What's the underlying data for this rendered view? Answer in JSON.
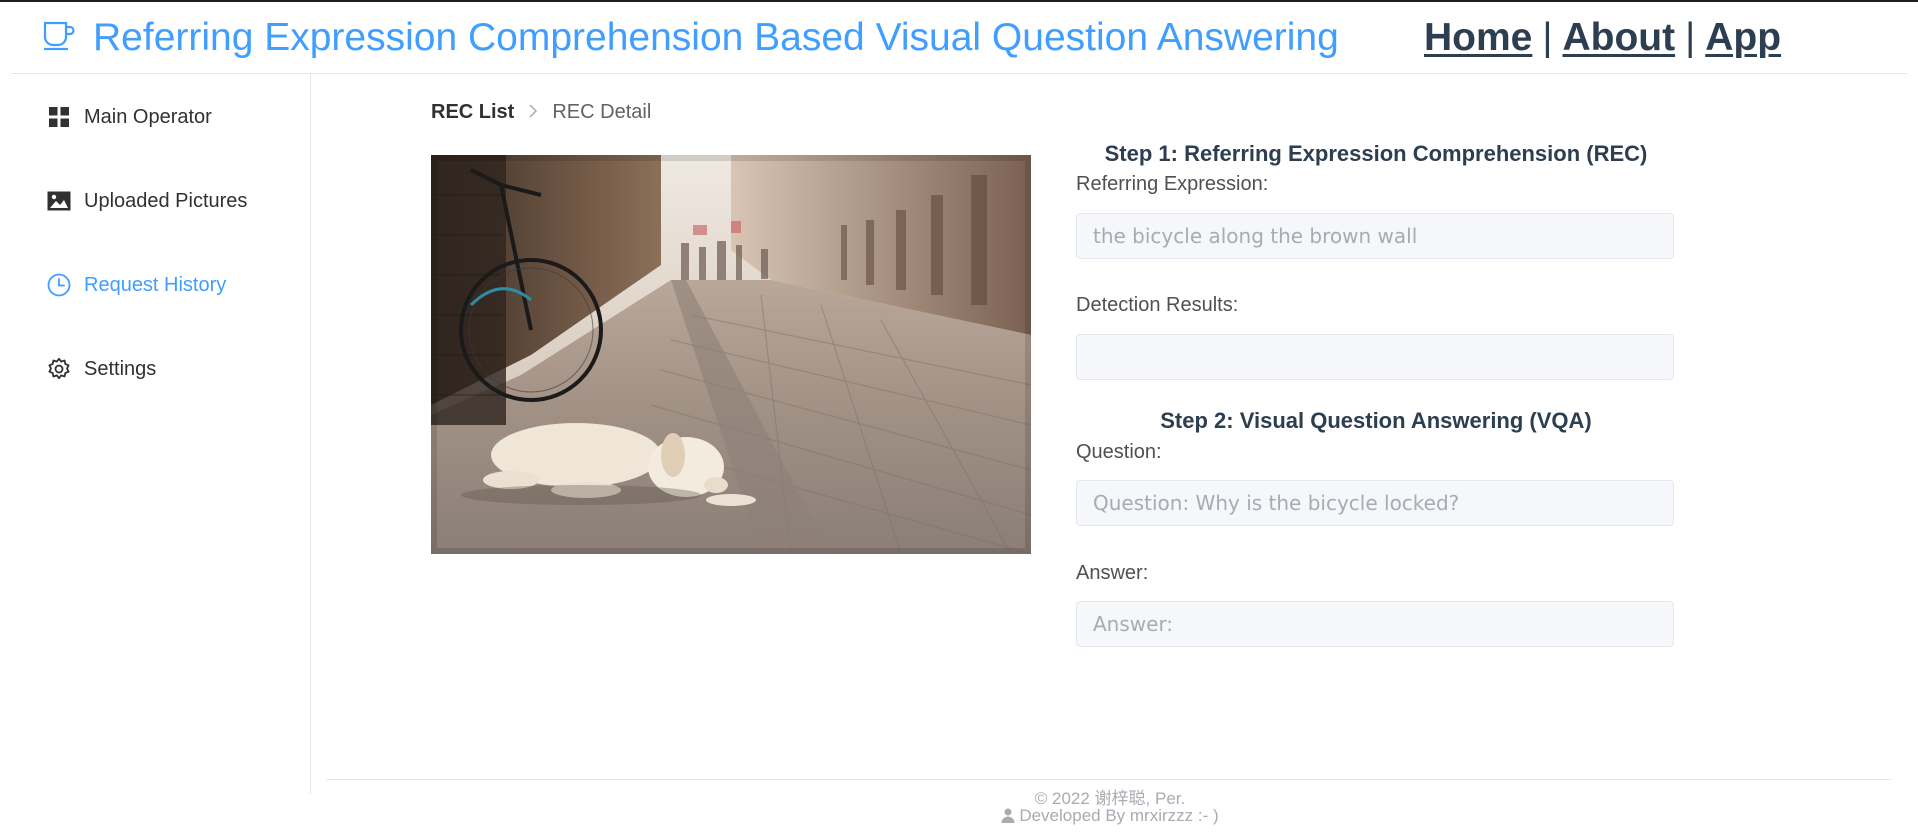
{
  "header": {
    "logo_icon": "coffee-cup-icon",
    "title": "Referring Expression Comprehension Based Visual Question Answering",
    "nav": [
      {
        "label": "Home"
      },
      {
        "label": "About"
      },
      {
        "label": "App"
      }
    ],
    "nav_separator": "|",
    "title_color": "#409eff"
  },
  "sidebar": {
    "items": [
      {
        "label": "Main Operator",
        "icon": "grid-icon",
        "active": false
      },
      {
        "label": "Uploaded Pictures",
        "icon": "picture-icon",
        "active": false
      },
      {
        "label": "Request History",
        "icon": "clock-icon",
        "active": true
      },
      {
        "label": "Settings",
        "icon": "gear-icon",
        "active": false
      }
    ],
    "active_color": "#409eff"
  },
  "breadcrumb": {
    "items": [
      "REC List",
      "REC Detail"
    ]
  },
  "photo": {
    "subject": "a white puppy lying on a cobblestone street beside a bicycle"
  },
  "form": {
    "step1_title": "Step 1: Referring Expression Comprehension (REC)",
    "ref_expression_label": "Referring Expression:",
    "ref_expression_value": "the bicycle along the brown wall",
    "detection_label": "Detection Results:",
    "detection_value": "",
    "step2_title": "Step 2: Visual Question Answering (VQA)",
    "question_label": "Question:",
    "question_value": "Question: Why is the bicycle locked?",
    "answer_label": "Answer:",
    "answer_value": "Answer:"
  },
  "footer": {
    "copyright": "© 2022 谢梓聪, Per.",
    "developer_icon": "user-icon",
    "developer": "Developed By mrxirzzz :- )"
  }
}
